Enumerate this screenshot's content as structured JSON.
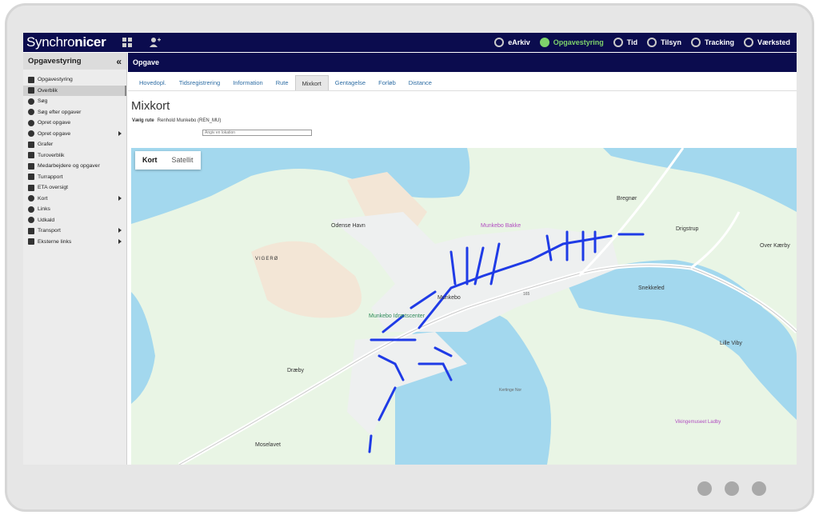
{
  "app": {
    "logo_light": "Synchro",
    "logo_bold": "nicer"
  },
  "topnav": [
    {
      "label": "eArkiv",
      "icon": "archive-icon",
      "active": false
    },
    {
      "label": "Opgavestyring",
      "icon": "task-icon",
      "active": true
    },
    {
      "label": "Tid",
      "icon": "clock-icon",
      "active": false
    },
    {
      "label": "Tilsyn",
      "icon": "eye-icon",
      "active": false
    },
    {
      "label": "Tracking",
      "icon": "signal-icon",
      "active": false
    },
    {
      "label": "Værksted",
      "icon": "wrench-icon",
      "active": false
    }
  ],
  "sidebar": {
    "title": "Opgavestyring",
    "collapse": "«",
    "items": [
      {
        "label": "Opgavestyring",
        "icon": "sitemap-icon"
      },
      {
        "label": "Overblik",
        "icon": "sitemap-icon"
      },
      {
        "label": "Søg",
        "icon": "search-icon"
      },
      {
        "label": "Søg efter opgaver",
        "icon": "search-icon"
      },
      {
        "label": "Opret opgave",
        "icon": "plus-circle-icon"
      },
      {
        "label": "Opret opgave",
        "icon": "plus-circle-icon"
      },
      {
        "label": "Grafer",
        "icon": "chart-icon"
      },
      {
        "label": "Turoverblik",
        "icon": "list-icon"
      },
      {
        "label": "Medarbejdere og opgaver",
        "icon": "list-icon"
      },
      {
        "label": "Turrapport",
        "icon": "file-icon"
      },
      {
        "label": "ETA oversigt",
        "icon": "list-icon"
      },
      {
        "label": "Kort",
        "icon": "map-marker-icon"
      },
      {
        "label": "Links",
        "icon": "link-icon"
      },
      {
        "label": "Udkald",
        "icon": "phone-icon"
      },
      {
        "label": "Transport",
        "icon": "truck-icon"
      },
      {
        "label": "Eksterne links",
        "icon": "external-link-icon"
      }
    ]
  },
  "main": {
    "header": "Opgave",
    "tabs": [
      "Hovedopl.",
      "Tidsregistrering",
      "Information",
      "Rute",
      "Mixkort",
      "Gentagelse",
      "Forløb",
      "Distance"
    ],
    "title": "Mixkort",
    "route_label": "Vælg rute",
    "route_value": "Renhold Munkebo (REN_MU)",
    "search_placeholder": "Angiv en lokation"
  },
  "map": {
    "toggle": [
      "Kort",
      "Satellit"
    ],
    "labels": {
      "odense_havn": "Odense Havn",
      "munkebo_bakke": "Munkebo Bakke",
      "vigero": "VIGERØ",
      "munkebo": "Munkebo",
      "idraetscenter": "Munkebo Idrætscenter",
      "braegnor": "Bregnør",
      "drigstrup": "Drigstrup",
      "over_kaerby": "Over Kærby",
      "snekkeled": "Snekkeled",
      "lille_viby": "Lille Viby",
      "draeby": "Dræby",
      "moselavet": "Moselavet",
      "vikingemuseet": "Vikingemuseet Ladby",
      "kertinge_nor": "Kertinge Nor",
      "road_165": "165"
    }
  },
  "colors": {
    "navy": "#0b0c4e",
    "active_green": "#7fd36b",
    "water": "#a3d8ee",
    "land": "#e9f5e5",
    "route": "#1f3be6"
  }
}
